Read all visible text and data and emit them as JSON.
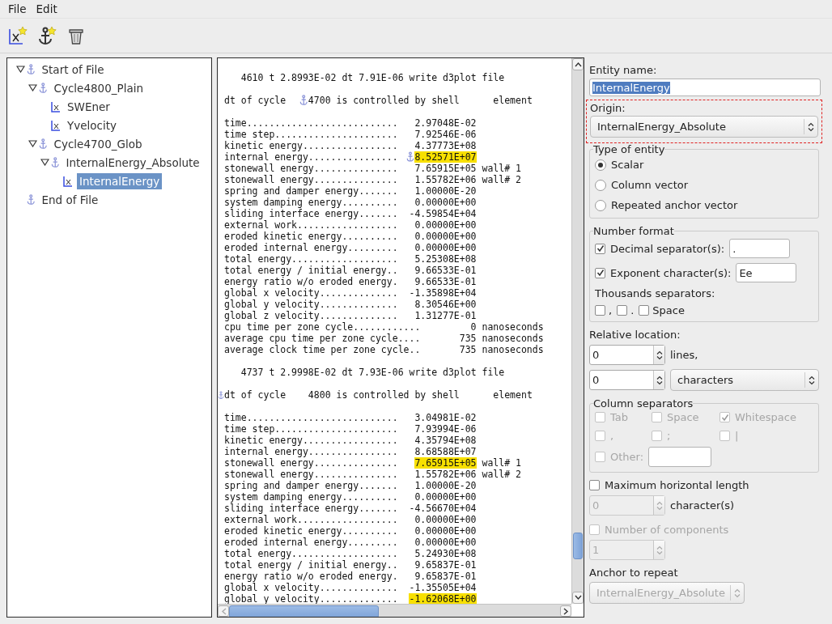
{
  "menu": [
    "File",
    "Edit"
  ],
  "tree": [
    {
      "label": "Start of File",
      "kind": "anchor",
      "expanded": true,
      "selected": false,
      "children": [
        {
          "label": "Cycle4800_Plain",
          "kind": "anchor",
          "expanded": true,
          "selected": false,
          "children": [
            {
              "label": "SWEner",
              "kind": "variable",
              "selected": false
            },
            {
              "label": "Yvelocity",
              "kind": "variable",
              "selected": false
            }
          ]
        },
        {
          "label": "Cycle4700_Glob",
          "kind": "anchor",
          "expanded": true,
          "selected": false,
          "children": [
            {
              "label": "InternalEnergy_Absolute",
              "kind": "anchor",
              "expanded": true,
              "selected": false,
              "children": [
                {
                  "label": "InternalEnergy",
                  "kind": "variable",
                  "selected": true
                }
              ]
            }
          ]
        }
      ]
    },
    {
      "label": "End of File",
      "kind": "anchor",
      "selected": false
    }
  ],
  "text_view": {
    "lines": [
      {
        "kind": "write",
        "text": "4610 t 2.8993E-02 dt 7.91E-06 write d3plot file"
      },
      {
        "kind": "blank"
      },
      {
        "kind": "cycle",
        "prefix": "dt of cycle",
        "rest": "4700 is controlled by shell      element",
        "line_anchored": false,
        "number_anchored": true
      },
      {
        "kind": "blank"
      },
      {
        "kind": "data",
        "label": "time...........................",
        "value": "2.97048E-02",
        "highlighted": false
      },
      {
        "kind": "data",
        "label": "time step......................",
        "value": "7.92546E-06",
        "highlighted": false
      },
      {
        "kind": "data",
        "label": "kinetic energy.................",
        "value": "4.37773E+08",
        "highlighted": false
      },
      {
        "kind": "data",
        "label": "internal energy................",
        "value": "8.52571E+07",
        "highlighted": true,
        "anchored": true
      },
      {
        "kind": "data",
        "label": "stonewall energy...............",
        "value": "7.65915E+05",
        "suffix": "wall# 1",
        "highlighted": false
      },
      {
        "kind": "data",
        "label": "stonewall energy...............",
        "value": "1.55782E+06",
        "suffix": "wall# 2",
        "highlighted": false
      },
      {
        "kind": "data",
        "label": "spring and damper energy.......",
        "value": "1.00000E-20",
        "highlighted": false
      },
      {
        "kind": "data",
        "label": "system damping energy..........",
        "value": "0.00000E+00",
        "highlighted": false
      },
      {
        "kind": "data",
        "label": "sliding interface energy.......",
        "value": "-4.59854E+04",
        "highlighted": false
      },
      {
        "kind": "data",
        "label": "external work..................",
        "value": "0.00000E+00",
        "highlighted": false
      },
      {
        "kind": "data",
        "label": "eroded kinetic energy..........",
        "value": "0.00000E+00",
        "highlighted": false
      },
      {
        "kind": "data",
        "label": "eroded internal energy.........",
        "value": "0.00000E+00",
        "highlighted": false
      },
      {
        "kind": "data",
        "label": "total energy...................",
        "value": "5.25308E+08",
        "highlighted": false
      },
      {
        "kind": "data",
        "label": "total energy / initial energy..",
        "value": "9.66533E-01",
        "highlighted": false
      },
      {
        "kind": "data",
        "label": "energy ratio w/o eroded energy.",
        "value": "9.66533E-01",
        "highlighted": false
      },
      {
        "kind": "data",
        "label": "global x velocity..............",
        "value": "-1.35898E+04",
        "highlighted": false
      },
      {
        "kind": "data",
        "label": "global y velocity..............",
        "value": "8.30546E+00",
        "highlighted": false
      },
      {
        "kind": "data",
        "label": "global z velocity..............",
        "value": "1.31277E-01",
        "highlighted": false
      },
      {
        "kind": "data",
        "label": "cpu time per zone cycle............",
        "value": "0",
        "suffix": "nanoseconds",
        "highlighted": false
      },
      {
        "kind": "data",
        "label": "average cpu time per zone cycle....",
        "value": "735",
        "suffix": "nanoseconds",
        "highlighted": false
      },
      {
        "kind": "data",
        "label": "average clock time per zone cycle..",
        "value": "735",
        "suffix": "nanoseconds",
        "highlighted": false
      },
      {
        "kind": "blank"
      },
      {
        "kind": "write",
        "text": "4737 t 2.9998E-02 dt 7.93E-06 write d3plot file"
      },
      {
        "kind": "blank"
      },
      {
        "kind": "cycle",
        "prefix": "dt of cycle",
        "rest": "4800 is controlled by shell      element",
        "line_anchored": true,
        "number_anchored": false
      },
      {
        "kind": "blank"
      },
      {
        "kind": "data",
        "label": "time...........................",
        "value": "3.04981E-02",
        "highlighted": false
      },
      {
        "kind": "data",
        "label": "time step......................",
        "value": "7.93994E-06",
        "highlighted": false
      },
      {
        "kind": "data",
        "label": "kinetic energy.................",
        "value": "4.35794E+08",
        "highlighted": false
      },
      {
        "kind": "data",
        "label": "internal energy................",
        "value": "8.68588E+07",
        "highlighted": false
      },
      {
        "kind": "data",
        "label": "stonewall energy...............",
        "value": "7.65915E+05",
        "suffix": "wall# 1",
        "highlighted": true
      },
      {
        "kind": "data",
        "label": "stonewall energy...............",
        "value": "1.55782E+06",
        "suffix": "wall# 2",
        "highlighted": false
      },
      {
        "kind": "data",
        "label": "spring and damper energy.......",
        "value": "1.00000E-20",
        "highlighted": false
      },
      {
        "kind": "data",
        "label": "system damping energy..........",
        "value": "0.00000E+00",
        "highlighted": false
      },
      {
        "kind": "data",
        "label": "sliding interface energy.......",
        "value": "-4.56670E+04",
        "highlighted": false
      },
      {
        "kind": "data",
        "label": "external work..................",
        "value": "0.00000E+00",
        "highlighted": false
      },
      {
        "kind": "data",
        "label": "eroded kinetic energy..........",
        "value": "0.00000E+00",
        "highlighted": false
      },
      {
        "kind": "data",
        "label": "eroded internal energy.........",
        "value": "0.00000E+00",
        "highlighted": false
      },
      {
        "kind": "data",
        "label": "total energy...................",
        "value": "5.24930E+08",
        "highlighted": false
      },
      {
        "kind": "data",
        "label": "total energy / initial energy..",
        "value": "9.65837E-01",
        "highlighted": false
      },
      {
        "kind": "data",
        "label": "energy ratio w/o eroded energy.",
        "value": "9.65837E-01",
        "highlighted": false
      },
      {
        "kind": "data",
        "label": "global x velocity..............",
        "value": "-1.35505E+04",
        "highlighted": false
      },
      {
        "kind": "data",
        "label": "global y velocity..............",
        "value": "-1.62068E+00",
        "highlighted": true
      }
    ]
  },
  "entity_name": {
    "label": "Entity name:",
    "value": "InternalEnergy",
    "text_selected": true
  },
  "origin": {
    "label": "Origin:",
    "value": "InternalEnergy_Absolute",
    "highlighted": true
  },
  "type_of_entity": {
    "title": "Type of entity",
    "options": [
      {
        "label": "Scalar",
        "selected": true
      },
      {
        "label": "Column vector",
        "selected": false
      },
      {
        "label": "Repeated anchor vector",
        "selected": false
      }
    ]
  },
  "number_format": {
    "title": "Number format",
    "decimal": {
      "label": "Decimal separator(s):",
      "checked": true,
      "value": "."
    },
    "exponent": {
      "label": "Exponent character(s):",
      "checked": true,
      "value": "Ee"
    },
    "thousands_label": "Thousands separators:",
    "thousands": [
      {
        "label": ",",
        "checked": false
      },
      {
        "label": ".",
        "checked": false
      },
      {
        "label": "Space",
        "checked": false
      }
    ]
  },
  "relative_location": {
    "label": "Relative location:",
    "lines_value": "0",
    "lines_unit": "lines,",
    "chars_value": "0",
    "chars_unit": "characters"
  },
  "column_separators": {
    "title": "Column separators",
    "disabled": true,
    "options": [
      {
        "label": "Tab",
        "checked": false
      },
      {
        "label": "Space",
        "checked": false
      },
      {
        "label": "Whitespace",
        "checked": true
      },
      {
        "label": ",",
        "checked": false
      },
      {
        "label": ";",
        "checked": false
      },
      {
        "label": "|",
        "checked": false
      }
    ],
    "other": {
      "label": "Other:",
      "checked": false
    }
  },
  "max_length": {
    "label": "Maximum horizontal length",
    "checked": false,
    "disabled": false,
    "value": "0",
    "unit": "character(s)",
    "spin_disabled": true
  },
  "components": {
    "label": "Number of components",
    "checked": false,
    "disabled": true,
    "value": "1"
  },
  "anchor_repeat": {
    "label": "Anchor to repeat",
    "value": "InternalEnergy_Absolute",
    "disabled": true
  }
}
